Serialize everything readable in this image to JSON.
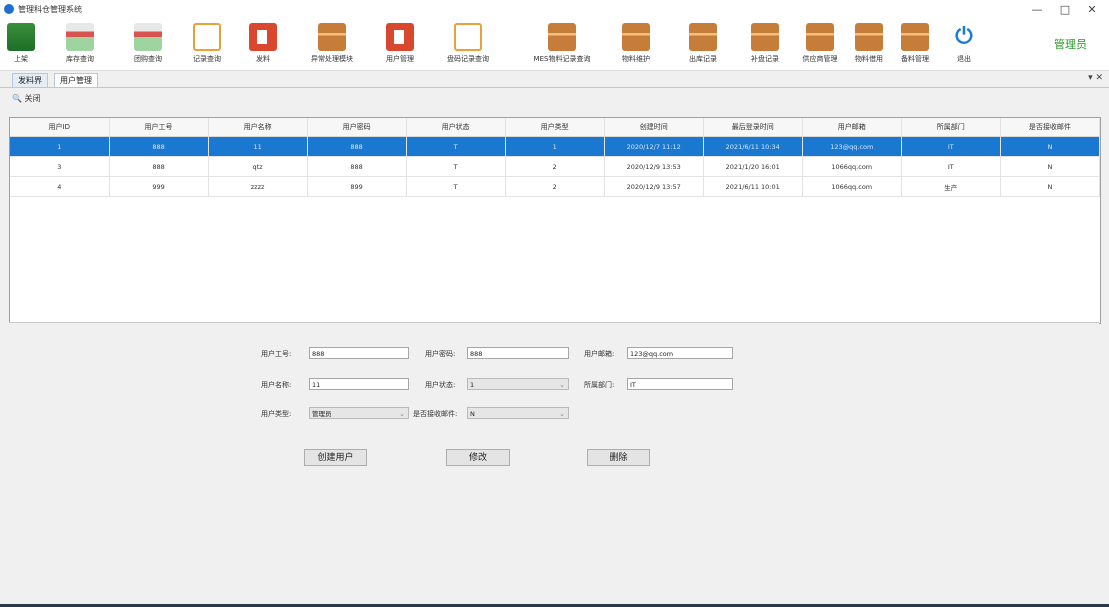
{
  "window": {
    "title": "管理科仓管理系统",
    "minimize": "—",
    "maximize": "□",
    "close": "✕"
  },
  "toolbar": {
    "items": [
      {
        "label": "上架",
        "icon": "green-app-icon"
      },
      {
        "label": "库存查询",
        "icon": "shop-icon"
      },
      {
        "label": "团购查询",
        "icon": "shop-icon"
      },
      {
        "label": "记录查询",
        "icon": "note-icon"
      },
      {
        "label": "发料",
        "icon": "red-tag-icon"
      },
      {
        "label": "异常处理模块",
        "icon": "box-icon"
      },
      {
        "label": "用户管理",
        "icon": "red-tag-icon"
      },
      {
        "label": "盘码记录查询",
        "icon": "note-icon"
      },
      {
        "label": "MES物料记录查询",
        "icon": "box-icon"
      },
      {
        "label": "物料维护",
        "icon": "box-icon"
      },
      {
        "label": "出库记录",
        "icon": "box-icon"
      },
      {
        "label": "补盘记录",
        "icon": "box-icon"
      },
      {
        "label": "供应商管理",
        "icon": "box-icon"
      },
      {
        "label": "物料借用",
        "icon": "box-icon"
      },
      {
        "label": "备料管理",
        "icon": "box-icon"
      },
      {
        "label": "退出",
        "icon": "power-icon"
      }
    ],
    "admin_label": "管理员"
  },
  "tabs": [
    {
      "label": "发料界"
    },
    {
      "label": "用户管理"
    }
  ],
  "tab_close": "▾ ✕",
  "close_button": "关闭",
  "grid": {
    "columns": [
      "用户ID",
      "用户工号",
      "用户名称",
      "用户密码",
      "用户状态",
      "用户类型",
      "创建时间",
      "最后登录时间",
      "用户邮箱",
      "所属部门",
      "是否接收邮件"
    ],
    "rows": [
      [
        "1",
        "888",
        "11",
        "888",
        "T",
        "1",
        "2020/12/7 11:12",
        "2021/6/11 10:34",
        "123@qq.com",
        "IT",
        "N"
      ],
      [
        "3",
        "888",
        "qtz",
        "888",
        "T",
        "2",
        "2020/12/9 13:53",
        "2021/1/20 16:01",
        "1066qq.com",
        "IT",
        "N"
      ],
      [
        "4",
        "999",
        "zzzz",
        "899",
        "T",
        "2",
        "2020/12/9 13:57",
        "2021/6/11 10:01",
        "1066qq.com",
        "生产",
        "N"
      ]
    ]
  },
  "form": {
    "job_no_label": "用户工号:",
    "job_no_value": "888",
    "password_label": "用户密码:",
    "password_value": "888",
    "email_label": "用户邮箱:",
    "email_value": "123@qq.com",
    "name_label": "用户名称:",
    "name_value": "11",
    "status_label": "用户状态:",
    "status_value": "1",
    "dept_label": "所属部门:",
    "dept_value": "IT",
    "type_label": "用户类型:",
    "type_value": "管理员",
    "mail_label": "是否接收邮件:",
    "mail_value": "N",
    "create_button": "创建用户",
    "edit_button": "修改",
    "delete_button": "删除"
  }
}
